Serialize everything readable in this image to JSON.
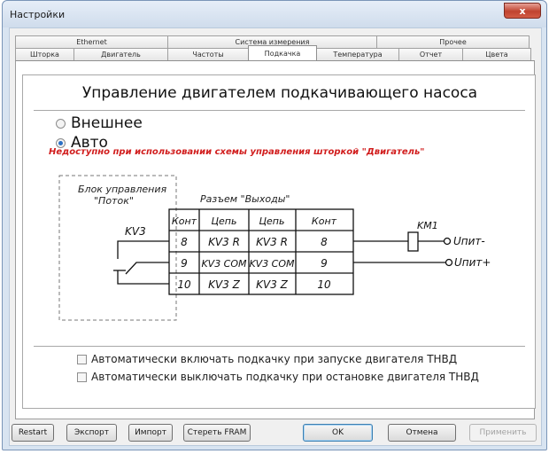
{
  "window": {
    "title": "Настройки",
    "close_glyph": "x"
  },
  "tabs_top": [
    "Ethernet",
    "Система измерения",
    "Прочее"
  ],
  "tabs_bottom": [
    "Шторка",
    "Двигатель",
    "Частоты",
    "Подкачка",
    "Температура",
    "Отчет",
    "Цвета"
  ],
  "active_tab": "Подкачка",
  "panel": {
    "heading": "Управление двигателем подкачивающего насоса",
    "radio_external": "Внешнее",
    "radio_auto": "Авто",
    "selected_radio": "Авто",
    "warning": "Недоступно при использовании схемы управления шторкой \"Двигатель\""
  },
  "diagram": {
    "block_label_1": "Блок управления",
    "block_label_2": "\"Поток\"",
    "connector_label": "Разъем \"Выходы\"",
    "relay_label": "KV3",
    "coil_label": "KM1",
    "supply_minus": "Uпит-",
    "supply_plus": "Uпит+",
    "table_headers": [
      "Конт",
      "Цепь",
      "Цепь",
      "Конт"
    ],
    "table_rows": [
      [
        "8",
        "KV3 R",
        "KV3 R",
        "8"
      ],
      [
        "9",
        "KV3 COM",
        "KV3 COM",
        "9"
      ],
      [
        "10",
        "KV3 Z",
        "KV3 Z",
        "10"
      ]
    ]
  },
  "checkboxes": {
    "auto_on": "Автоматически включать подкачку при запуске двигателя ТНВД",
    "auto_off": "Автоматически выключать подкачку при остановке двигателя ТНВД"
  },
  "buttons": {
    "restart": "Restart",
    "export": "Экспорт",
    "import": "Импорт",
    "erase_fram": "Стереть FRAM",
    "ok": "OK",
    "cancel": "Отмена",
    "apply": "Применить"
  }
}
